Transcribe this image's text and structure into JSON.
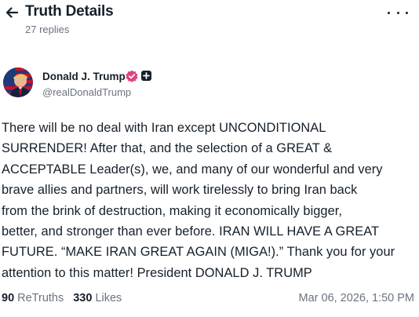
{
  "header": {
    "title": "Truth Details",
    "reply_count": "27 replies"
  },
  "post": {
    "author": {
      "name": "Donald J. Trump",
      "handle": "@realDonaldTrump"
    },
    "text": "There will be no deal with Iran except UNCONDITIONAL\nSURRENDER! After that, and the selection of a GREAT &\nACCEPTABLE Leader(s), we, and many of our wonderful and very\nbrave allies and partners, will work tirelessly to bring Iran back\nfrom the brink of destruction, making it economically bigger,\nbetter, and stronger than ever before. IRAN WILL HAVE A GREAT\nFUTURE. “MAKE IRAN GREAT AGAIN (MIGA!).” Thank you for your\nattention to this matter! President DONALD J. TRUMP",
    "retruths_count": "90",
    "retruths_label": "ReTruths",
    "likes_count": "330",
    "likes_label": "Likes",
    "timestamp": "Mar 06, 2026, 1:50 PM"
  },
  "icons": {
    "back": "arrow-left-icon",
    "more": "more-horizontal-icon",
    "verified": "verified-badge-icon",
    "plus": "plus-badge-icon"
  },
  "colors": {
    "text": "#15202b",
    "muted": "#6b7280",
    "verified": "#e0447c"
  }
}
